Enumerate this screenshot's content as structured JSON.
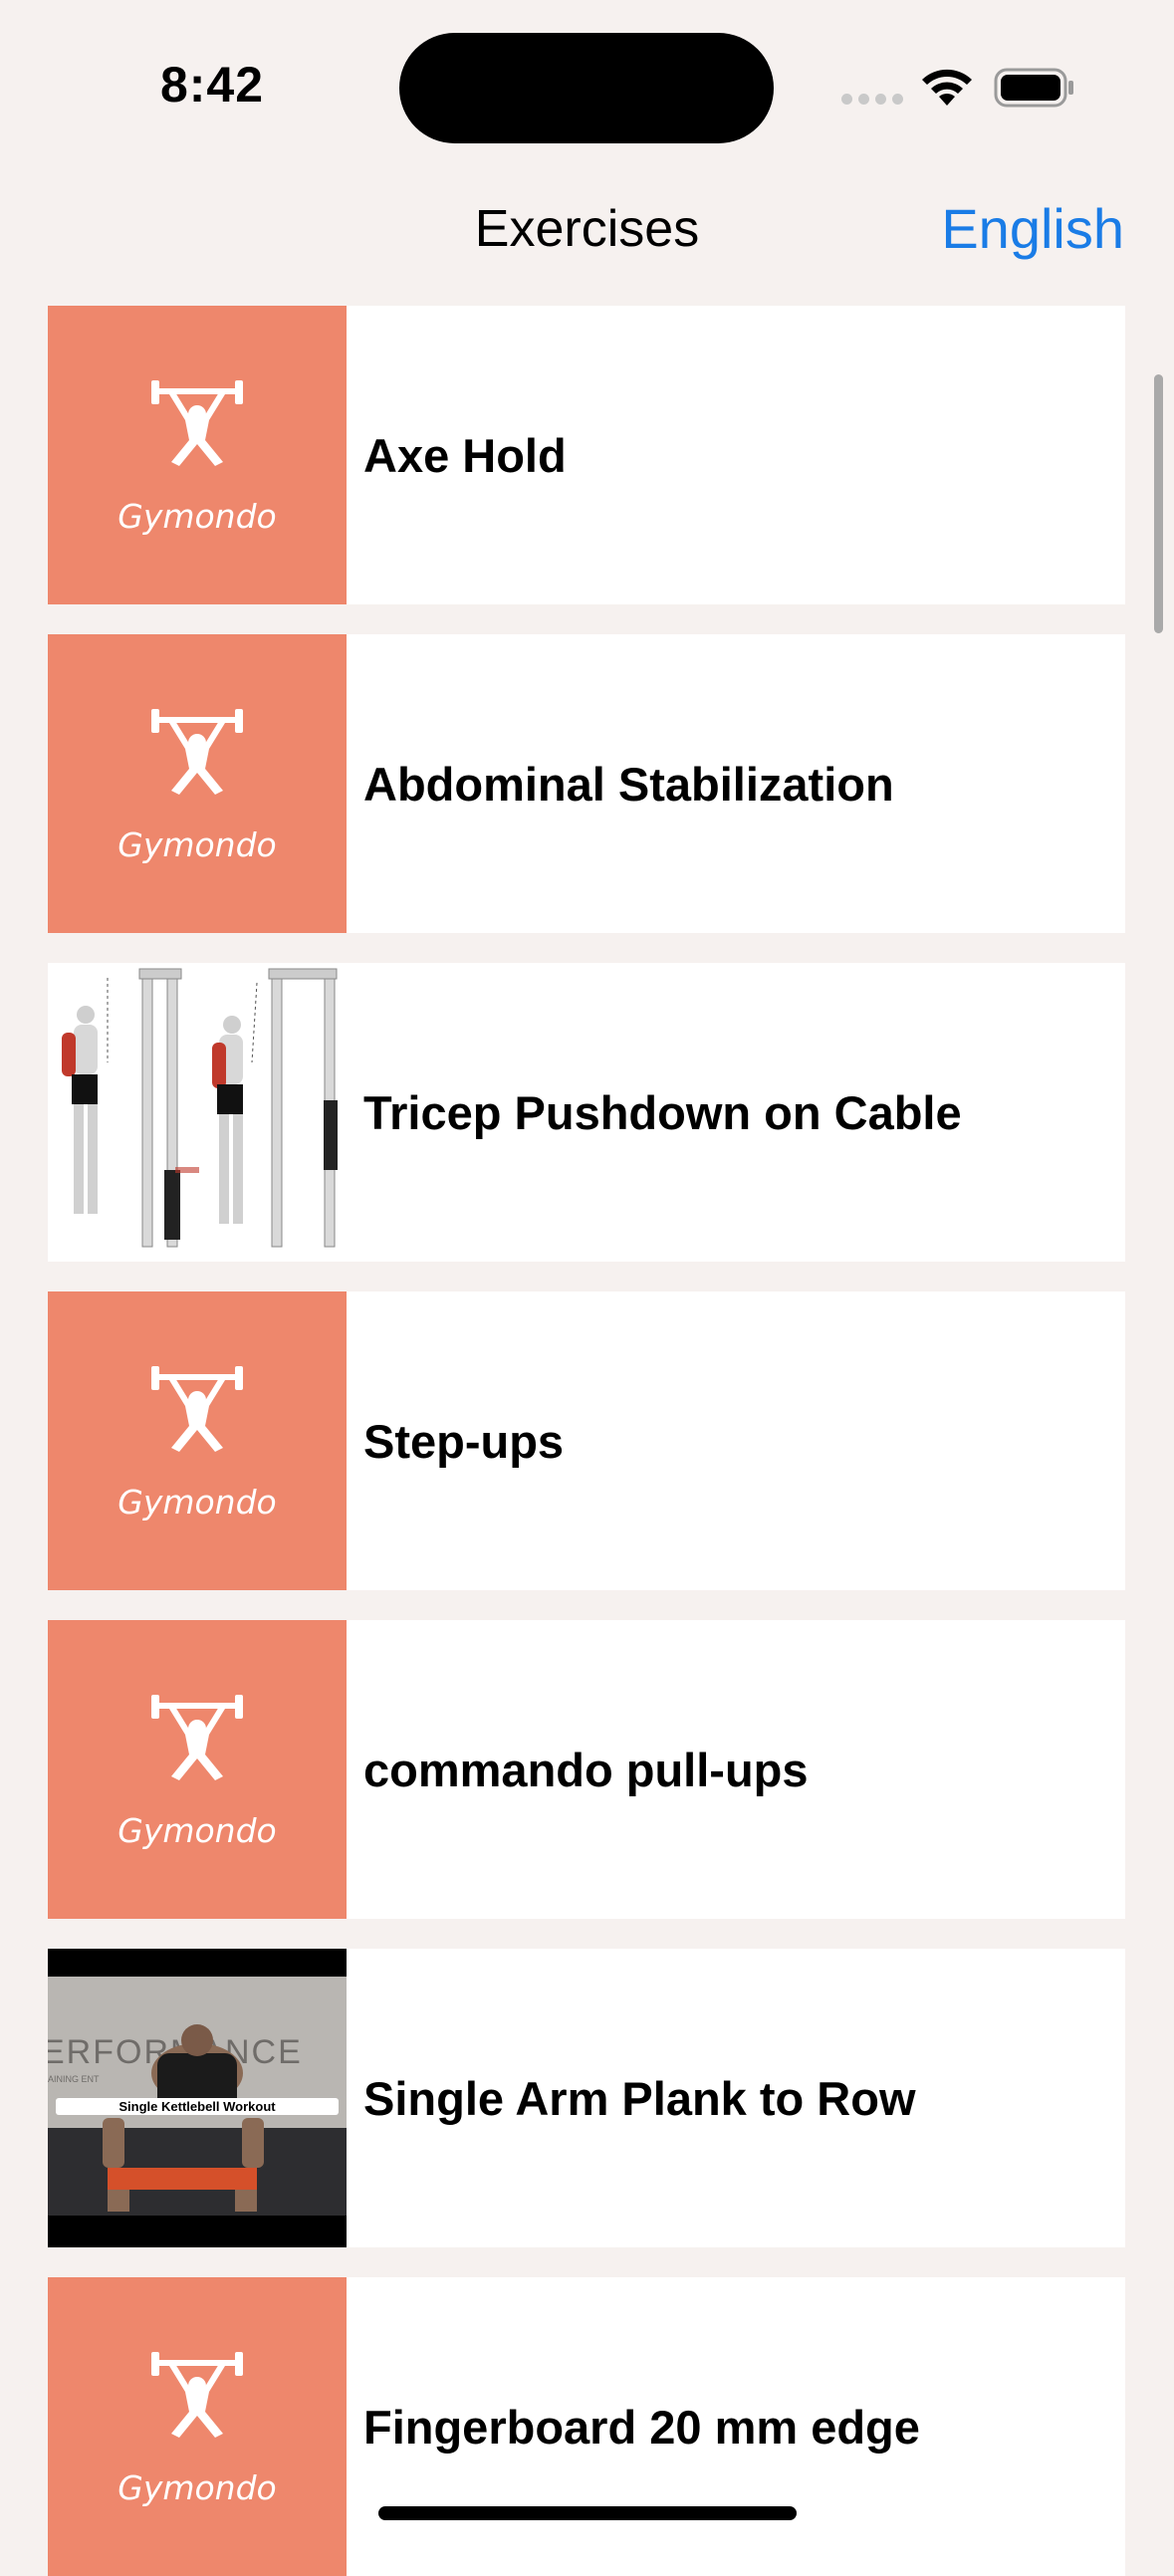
{
  "status_bar": {
    "time": "8:42"
  },
  "nav": {
    "title": "Exercises",
    "language_button": "English"
  },
  "exercises": [
    {
      "name": "Axe Hold",
      "thumbnail": "gymondo-logo",
      "logo_text": "Gymondo"
    },
    {
      "name": "Abdominal Stabilization",
      "thumbnail": "gymondo-logo",
      "logo_text": "Gymondo"
    },
    {
      "name": "Tricep Pushdown on Cable",
      "thumbnail": "tricep-pushdown-illustration"
    },
    {
      "name": "Step-ups",
      "thumbnail": "gymondo-logo",
      "logo_text": "Gymondo"
    },
    {
      "name": "commando pull-ups",
      "thumbnail": "gymondo-logo",
      "logo_text": "Gymondo"
    },
    {
      "name": "Single Arm Plank to Row",
      "thumbnail": "kettlebell-workout-photo",
      "photo_caption": "Single Kettlebell Workout",
      "photo_wall_text": "ERFORMANCE",
      "photo_wall_subtext": "AINING        ENT"
    },
    {
      "name": "Fingerboard 20 mm edge",
      "thumbnail": "gymondo-logo",
      "logo_text": "Gymondo"
    }
  ],
  "colors": {
    "background": "#F6F1EF",
    "logo_tile": "#EE876C",
    "accent_blue": "#1A7CE6",
    "row_background": "#FFFFFF"
  }
}
